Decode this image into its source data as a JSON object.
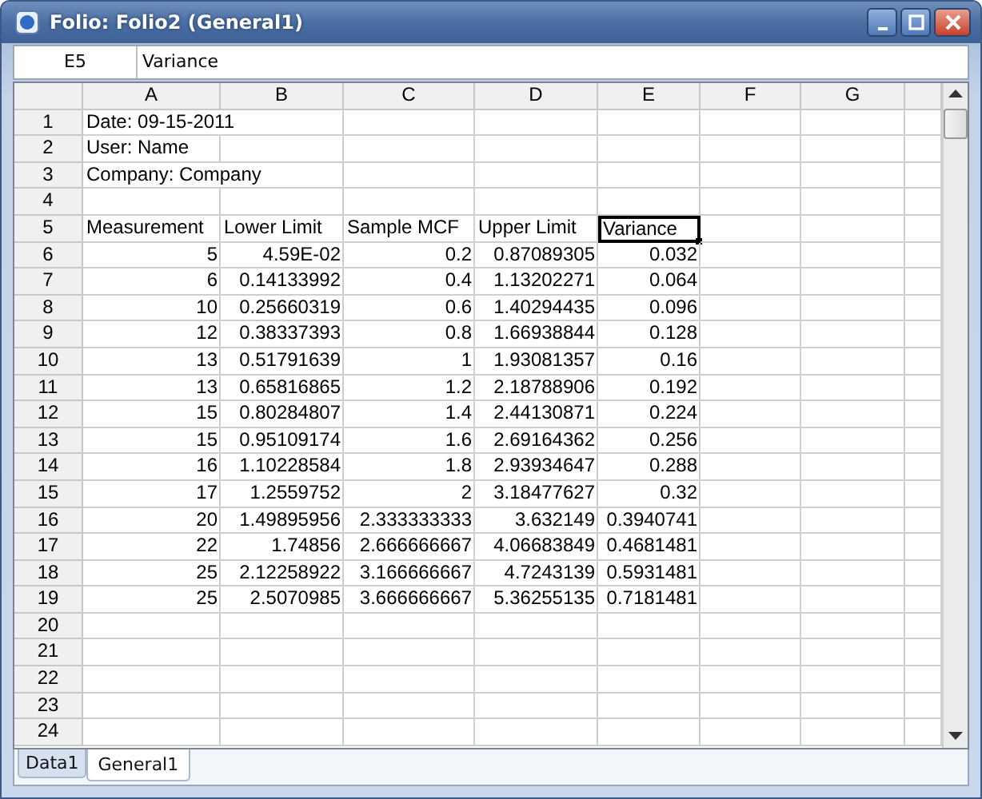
{
  "window": {
    "title": "Folio: Folio2 (General1)"
  },
  "formula_bar": {
    "cell": "E5",
    "value": "Variance"
  },
  "columns": [
    "A",
    "B",
    "C",
    "D",
    "E",
    "F",
    "G"
  ],
  "rows": [
    {
      "header": "1",
      "cells": [
        {
          "text": "Date: 09-15-2011",
          "kind": "text",
          "selected": false
        }
      ]
    },
    {
      "header": "2",
      "cells": [
        {
          "text": "User: Name",
          "kind": "text",
          "selected": false
        }
      ]
    },
    {
      "header": "3",
      "cells": [
        {
          "text": "Company: Company",
          "kind": "text",
          "selected": false
        }
      ]
    },
    {
      "header": "4",
      "cells": []
    },
    {
      "header": "5",
      "cells": [
        {
          "text": "Measurement",
          "kind": "text",
          "selected": false
        },
        {
          "text": "Lower Limit",
          "kind": "text",
          "selected": false
        },
        {
          "text": "Sample MCF",
          "kind": "text",
          "selected": false
        },
        {
          "text": "Upper Limit",
          "kind": "text",
          "selected": false
        },
        {
          "text": "Variance",
          "kind": "text",
          "selected": true
        }
      ]
    },
    {
      "header": "6",
      "cells": [
        {
          "text": "5",
          "kind": "number",
          "selected": false
        },
        {
          "text": "4.59E-02",
          "kind": "number",
          "selected": false
        },
        {
          "text": "0.2",
          "kind": "number",
          "selected": false
        },
        {
          "text": "0.87089305",
          "kind": "number",
          "selected": false
        },
        {
          "text": "0.032",
          "kind": "number",
          "selected": false
        }
      ]
    },
    {
      "header": "7",
      "cells": [
        {
          "text": "6",
          "kind": "number",
          "selected": false
        },
        {
          "text": "0.14133992",
          "kind": "number",
          "selected": false
        },
        {
          "text": "0.4",
          "kind": "number",
          "selected": false
        },
        {
          "text": "1.13202271",
          "kind": "number",
          "selected": false
        },
        {
          "text": "0.064",
          "kind": "number",
          "selected": false
        }
      ]
    },
    {
      "header": "8",
      "cells": [
        {
          "text": "10",
          "kind": "number",
          "selected": false
        },
        {
          "text": "0.25660319",
          "kind": "number",
          "selected": false
        },
        {
          "text": "0.6",
          "kind": "number",
          "selected": false
        },
        {
          "text": "1.40294435",
          "kind": "number",
          "selected": false
        },
        {
          "text": "0.096",
          "kind": "number",
          "selected": false
        }
      ]
    },
    {
      "header": "9",
      "cells": [
        {
          "text": "12",
          "kind": "number",
          "selected": false
        },
        {
          "text": "0.38337393",
          "kind": "number",
          "selected": false
        },
        {
          "text": "0.8",
          "kind": "number",
          "selected": false
        },
        {
          "text": "1.66938844",
          "kind": "number",
          "selected": false
        },
        {
          "text": "0.128",
          "kind": "number",
          "selected": false
        }
      ]
    },
    {
      "header": "10",
      "cells": [
        {
          "text": "13",
          "kind": "number",
          "selected": false
        },
        {
          "text": "0.51791639",
          "kind": "number",
          "selected": false
        },
        {
          "text": "1",
          "kind": "number",
          "selected": false
        },
        {
          "text": "1.93081357",
          "kind": "number",
          "selected": false
        },
        {
          "text": "0.16",
          "kind": "number",
          "selected": false
        }
      ]
    },
    {
      "header": "11",
      "cells": [
        {
          "text": "13",
          "kind": "number",
          "selected": false
        },
        {
          "text": "0.65816865",
          "kind": "number",
          "selected": false
        },
        {
          "text": "1.2",
          "kind": "number",
          "selected": false
        },
        {
          "text": "2.18788906",
          "kind": "number",
          "selected": false
        },
        {
          "text": "0.192",
          "kind": "number",
          "selected": false
        }
      ]
    },
    {
      "header": "12",
      "cells": [
        {
          "text": "15",
          "kind": "number",
          "selected": false
        },
        {
          "text": "0.80284807",
          "kind": "number",
          "selected": false
        },
        {
          "text": "1.4",
          "kind": "number",
          "selected": false
        },
        {
          "text": "2.44130871",
          "kind": "number",
          "selected": false
        },
        {
          "text": "0.224",
          "kind": "number",
          "selected": false
        }
      ]
    },
    {
      "header": "13",
      "cells": [
        {
          "text": "15",
          "kind": "number",
          "selected": false
        },
        {
          "text": "0.95109174",
          "kind": "number",
          "selected": false
        },
        {
          "text": "1.6",
          "kind": "number",
          "selected": false
        },
        {
          "text": "2.69164362",
          "kind": "number",
          "selected": false
        },
        {
          "text": "0.256",
          "kind": "number",
          "selected": false
        }
      ]
    },
    {
      "header": "14",
      "cells": [
        {
          "text": "16",
          "kind": "number",
          "selected": false
        },
        {
          "text": "1.10228584",
          "kind": "number",
          "selected": false
        },
        {
          "text": "1.8",
          "kind": "number",
          "selected": false
        },
        {
          "text": "2.93934647",
          "kind": "number",
          "selected": false
        },
        {
          "text": "0.288",
          "kind": "number",
          "selected": false
        }
      ]
    },
    {
      "header": "15",
      "cells": [
        {
          "text": "17",
          "kind": "number",
          "selected": false
        },
        {
          "text": "1.2559752",
          "kind": "number",
          "selected": false
        },
        {
          "text": "2",
          "kind": "number",
          "selected": false
        },
        {
          "text": "3.18477627",
          "kind": "number",
          "selected": false
        },
        {
          "text": "0.32",
          "kind": "number",
          "selected": false
        }
      ]
    },
    {
      "header": "16",
      "cells": [
        {
          "text": "20",
          "kind": "number",
          "selected": false
        },
        {
          "text": "1.49895956",
          "kind": "number",
          "selected": false
        },
        {
          "text": "2.333333333",
          "kind": "number",
          "selected": false
        },
        {
          "text": "3.632149",
          "kind": "number",
          "selected": false
        },
        {
          "text": "0.3940741",
          "kind": "number",
          "selected": false
        }
      ]
    },
    {
      "header": "17",
      "cells": [
        {
          "text": "22",
          "kind": "number",
          "selected": false
        },
        {
          "text": "1.74856",
          "kind": "number",
          "selected": false
        },
        {
          "text": "2.666666667",
          "kind": "number",
          "selected": false
        },
        {
          "text": "4.06683849",
          "kind": "number",
          "selected": false
        },
        {
          "text": "0.4681481",
          "kind": "number",
          "selected": false
        }
      ]
    },
    {
      "header": "18",
      "cells": [
        {
          "text": "25",
          "kind": "number",
          "selected": false
        },
        {
          "text": "2.12258922",
          "kind": "number",
          "selected": false
        },
        {
          "text": "3.166666667",
          "kind": "number",
          "selected": false
        },
        {
          "text": "4.7243139",
          "kind": "number",
          "selected": false
        },
        {
          "text": "0.5931481",
          "kind": "number",
          "selected": false
        }
      ]
    },
    {
      "header": "19",
      "cells": [
        {
          "text": "25",
          "kind": "number",
          "selected": false
        },
        {
          "text": "2.5070985",
          "kind": "number",
          "selected": false
        },
        {
          "text": "3.666666667",
          "kind": "number",
          "selected": false
        },
        {
          "text": "5.36255135",
          "kind": "number",
          "selected": false
        },
        {
          "text": "0.7181481",
          "kind": "number",
          "selected": false
        }
      ]
    },
    {
      "header": "20",
      "cells": []
    },
    {
      "header": "21",
      "cells": []
    },
    {
      "header": "22",
      "cells": []
    },
    {
      "header": "23",
      "cells": []
    },
    {
      "header": "24",
      "cells": []
    }
  ],
  "sheet_tabs": [
    {
      "label": "Data1",
      "selected": false
    },
    {
      "label": "General1",
      "selected": true
    }
  ]
}
